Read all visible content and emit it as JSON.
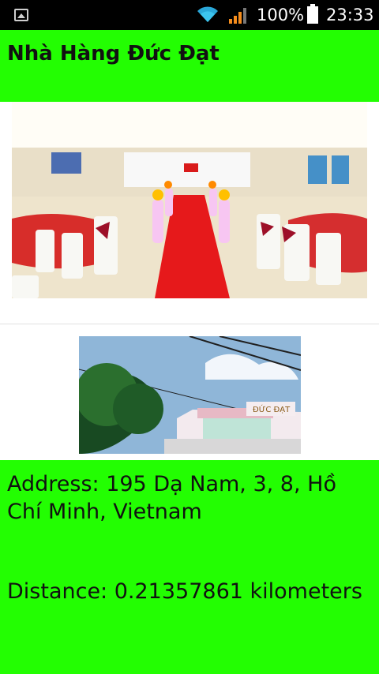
{
  "status_bar": {
    "battery_percent": "100%",
    "time": "23:33",
    "icons": [
      "image-notification-icon",
      "wifi-icon",
      "cell-signal-icon",
      "battery-icon"
    ]
  },
  "header": {
    "title": "Nhà Hàng Đức Đạt"
  },
  "images": [
    {
      "name": "banquet-hall-photo"
    },
    {
      "name": "restaurant-exterior-photo"
    }
  ],
  "details": {
    "address": "Address: 195 Dạ Nam, 3, 8, Hồ Chí Minh, Vietnam",
    "distance": "Distance: 0.21357861 kilometers"
  },
  "colors": {
    "accent_green": "#23fe02",
    "status_bar": "#000000",
    "text": "#111111"
  }
}
